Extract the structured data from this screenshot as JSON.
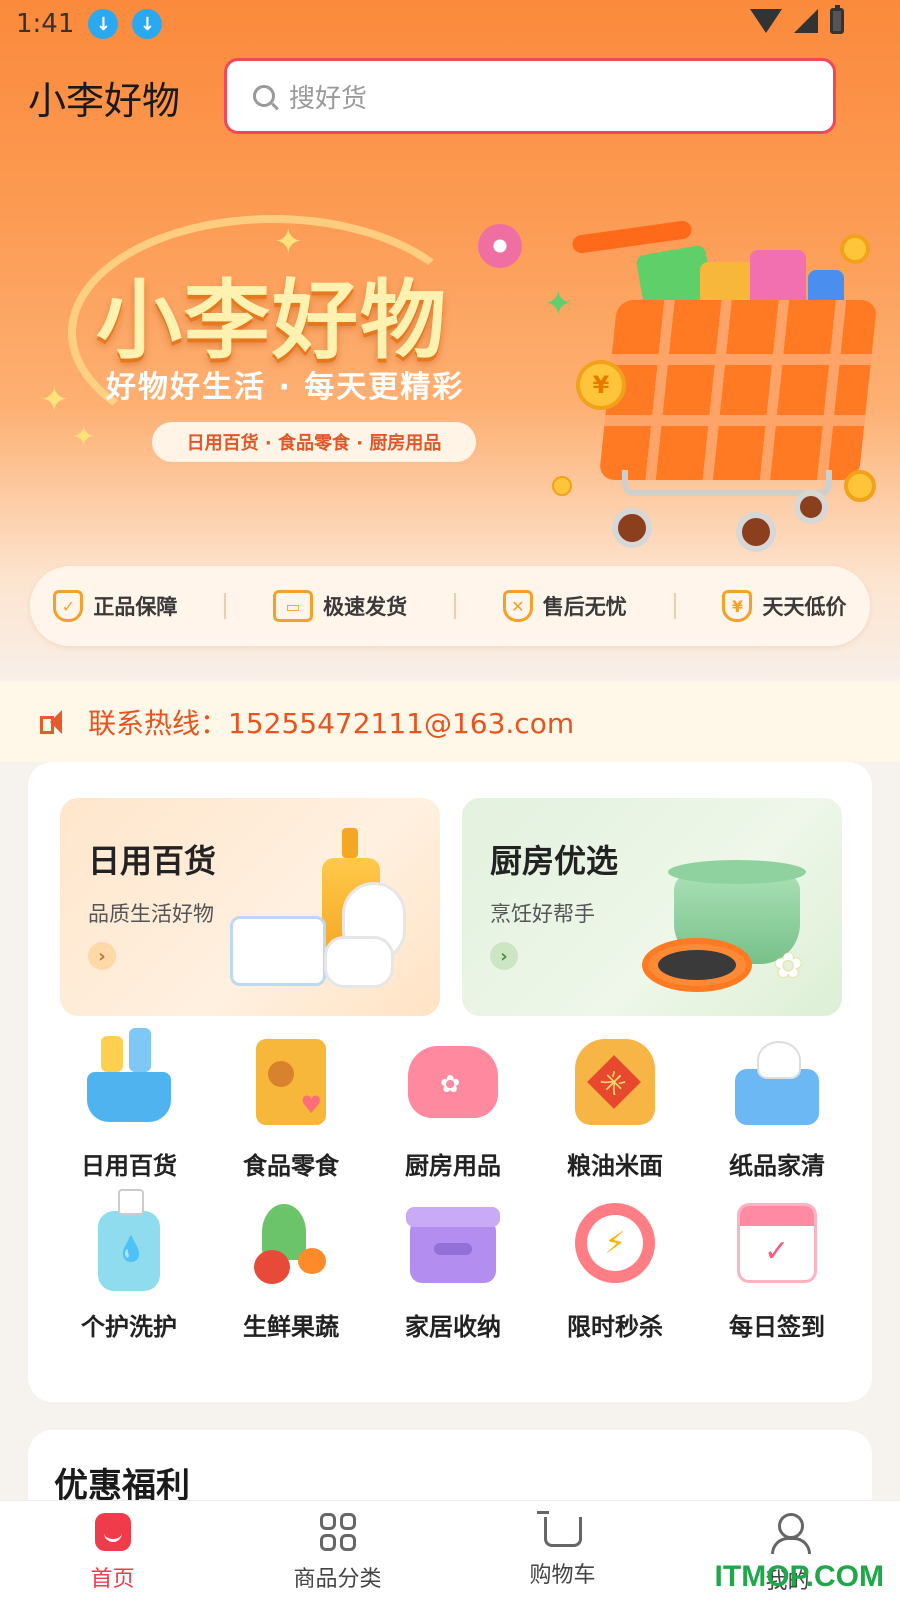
{
  "status_bar": {
    "time": "1:41"
  },
  "header": {
    "app_title": "小李好物"
  },
  "search": {
    "placeholder": "搜好货"
  },
  "banner": {
    "title": "小李好物",
    "slogan": "好物好生活 · 每天更精彩",
    "tags": "日用百货 · 食品零食 · 厨房用品",
    "coin_symbol": "¥"
  },
  "features": [
    {
      "label": "正品保障",
      "icon": "shield-check-icon"
    },
    {
      "label": "极速发货",
      "icon": "truck-icon"
    },
    {
      "label": "售后无忧",
      "icon": "shield-x-icon"
    },
    {
      "label": "天天低价",
      "icon": "yen-down-icon"
    }
  ],
  "notice": {
    "text": "联系热线：15255472111@163.com"
  },
  "promos": [
    {
      "title": "日用百货",
      "subtitle": "品质生活好物",
      "arrow": "›"
    },
    {
      "title": "厨房优选",
      "subtitle": "烹饪好帮手",
      "arrow": "›"
    }
  ],
  "categories": [
    {
      "label": "日用百货",
      "icon": "basket-icon"
    },
    {
      "label": "食品零食",
      "icon": "snack-bag-icon"
    },
    {
      "label": "厨房用品",
      "icon": "rice-cooker-icon"
    },
    {
      "label": "粮油米面",
      "icon": "rice-bag-icon"
    },
    {
      "label": "纸品家清",
      "icon": "tissue-box-icon"
    },
    {
      "label": "个护洗护",
      "icon": "pump-bottle-icon"
    },
    {
      "label": "生鲜果蔬",
      "icon": "vegetables-icon"
    },
    {
      "label": "家居收纳",
      "icon": "storage-box-icon"
    },
    {
      "label": "限时秒杀",
      "icon": "alarm-clock-icon"
    },
    {
      "label": "每日签到",
      "icon": "calendar-check-icon"
    }
  ],
  "coupon": {
    "title": "优惠福利"
  },
  "bottom_nav": [
    {
      "label": "首页",
      "active": true
    },
    {
      "label": "商品分类",
      "active": false
    },
    {
      "label": "购物车",
      "active": false
    },
    {
      "label": "我的",
      "active": false
    }
  ],
  "watermark": "ITMOP.COM",
  "colors": {
    "accent": "#f03c4a",
    "orange": "#fb8a3c",
    "notice_text": "#e8541f"
  }
}
